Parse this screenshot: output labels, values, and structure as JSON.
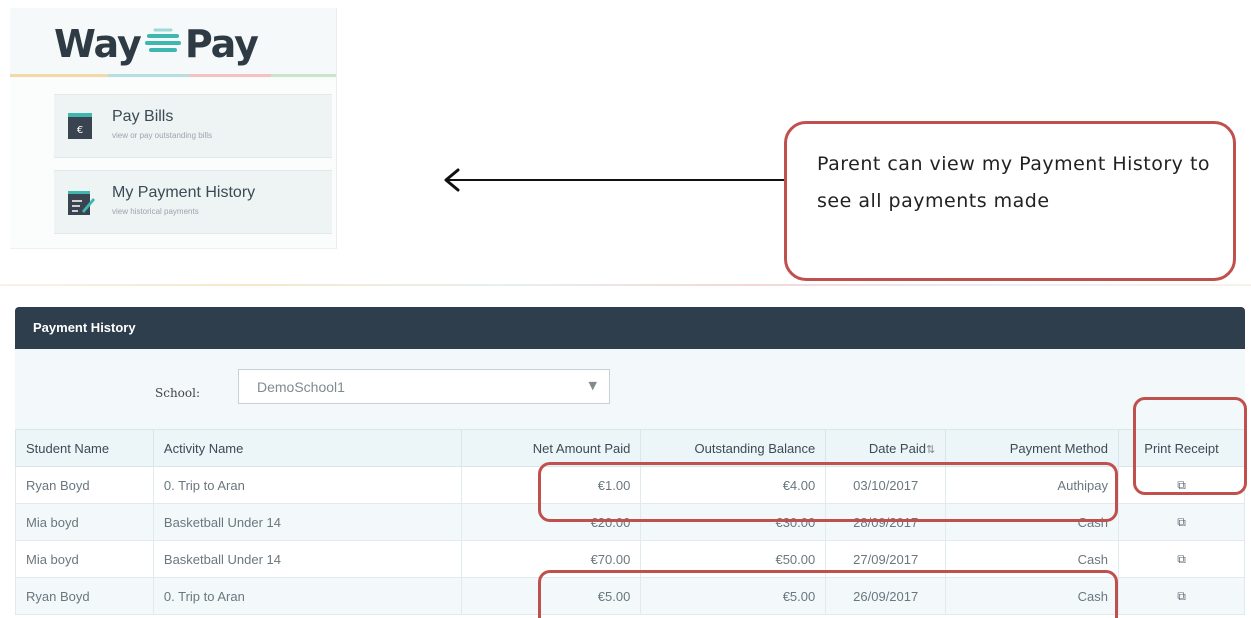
{
  "app": {
    "logo_left": "Way",
    "logo_right": "Pay",
    "menu": [
      {
        "title": "Pay Bills",
        "subtitle": "view or pay outstanding bills",
        "icon": "bill-euro-icon"
      },
      {
        "title": "My Payment History",
        "subtitle": "view historical payments",
        "icon": "history-edit-icon"
      }
    ]
  },
  "callout": {
    "text": "Parent can view my Payment History to see all payments made"
  },
  "payment_history": {
    "title": "Payment History",
    "school_label": "School:",
    "school_value": "DemoSchool1",
    "columns": [
      "Student Name",
      "Activity Name",
      "Net Amount Paid",
      "Outstanding Balance",
      "Date Paid",
      "Payment Method",
      "Print Receipt"
    ],
    "date_sort_glyph": "⇅",
    "rows": [
      {
        "student": "Ryan Boyd",
        "activity": "0. Trip to Aran",
        "net": "€1.00",
        "outstanding": "€4.00",
        "date": "03/10/2017",
        "method": "Authipay"
      },
      {
        "student": "Mia boyd",
        "activity": "Basketball Under 14",
        "net": "€20.00",
        "outstanding": "€30.00",
        "date": "28/09/2017",
        "method": "Cash"
      },
      {
        "student": "Mia boyd",
        "activity": "Basketball Under 14",
        "net": "€70.00",
        "outstanding": "€50.00",
        "date": "27/09/2017",
        "method": "Cash"
      },
      {
        "student": "Ryan Boyd",
        "activity": "0. Trip to Aran",
        "net": "€5.00",
        "outstanding": "€5.00",
        "date": "26/09/2017",
        "method": "Cash"
      }
    ]
  },
  "colors": {
    "highlight": "#c0504d",
    "header_bg": "#2e3e4d",
    "logo_accent": "#3fb6b0"
  }
}
